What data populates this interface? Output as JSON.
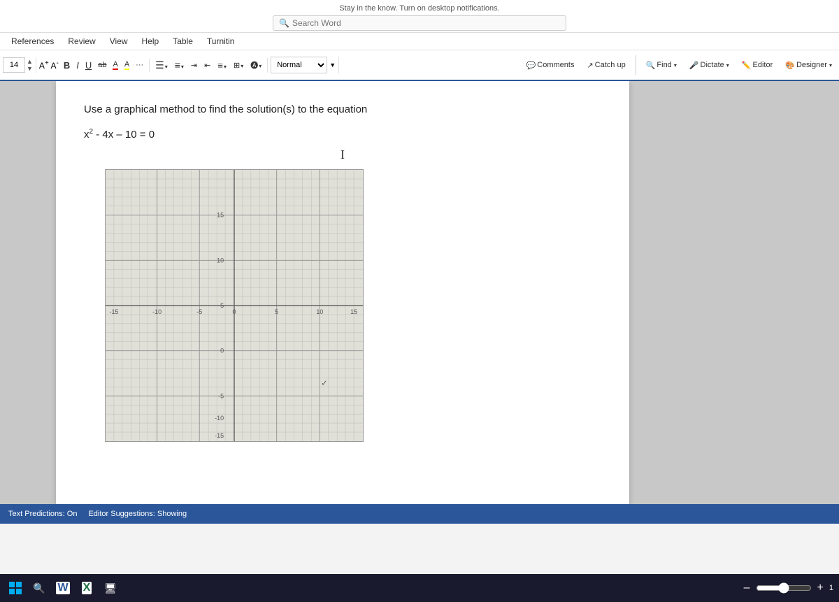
{
  "app": {
    "title": "Microsoft Word"
  },
  "search_bar": {
    "icon": "🔍",
    "placeholder": "Search",
    "notification": "Stay in the know. Turn on desktop notifications.",
    "search_word_placeholder": "Search Word"
  },
  "menu": {
    "items": [
      "References",
      "Review",
      "View",
      "Help",
      "Table",
      "Turnitin"
    ]
  },
  "ribbon": {
    "font_size": "14",
    "style_value": "Normal",
    "buttons": {
      "find": "Find",
      "dictate": "Dictate",
      "editor": "Editor",
      "designer": "Designer",
      "comments": "Comments",
      "catch_up": "Catch up"
    }
  },
  "document": {
    "heading": "Use a graphical method to find the solution(s) to the equation",
    "equation": "x² - 4x – 10 = 0",
    "cursor": "I"
  },
  "chart": {
    "x_labels": [
      "-15",
      "-10",
      "-5",
      "0",
      "5",
      "10",
      "15"
    ],
    "y_labels": [
      "15",
      "10",
      "5",
      "0",
      "-5",
      "-10",
      "-15"
    ],
    "title": "coordinate grid"
  },
  "status_bar": {
    "text_predictions": "Text Predictions: On",
    "editor_suggestions": "Editor Suggestions: Showing"
  },
  "taskbar": {
    "apps": [
      "windows",
      "search",
      "word",
      "excel",
      "os"
    ],
    "zoom_plus": "+",
    "zoom_minus": "–",
    "zoom_value": "1"
  }
}
